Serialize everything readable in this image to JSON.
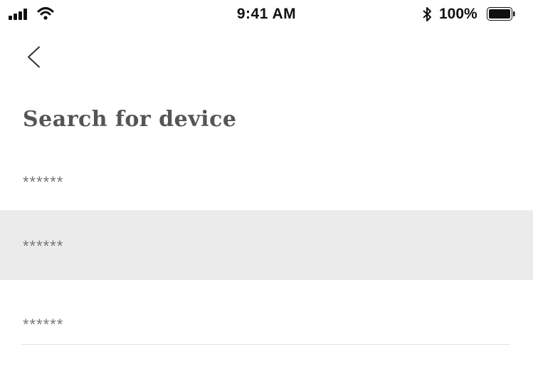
{
  "status_bar": {
    "time": "9:41 AM",
    "battery_percent": "100%",
    "battery_level": 1.0,
    "icons": [
      "signal-icon",
      "wifi-icon",
      "bluetooth-icon",
      "battery-icon"
    ]
  },
  "nav": {
    "back_icon": "chevron-left-icon"
  },
  "page": {
    "title": "Search for device"
  },
  "devices": [
    {
      "label": "******",
      "selected": false
    },
    {
      "label": "******",
      "selected": true
    },
    {
      "label": "******",
      "selected": false
    }
  ],
  "colors": {
    "selected_row_bg": "#ebebeb",
    "title_color": "#555555",
    "item_text_color": "#777777"
  }
}
